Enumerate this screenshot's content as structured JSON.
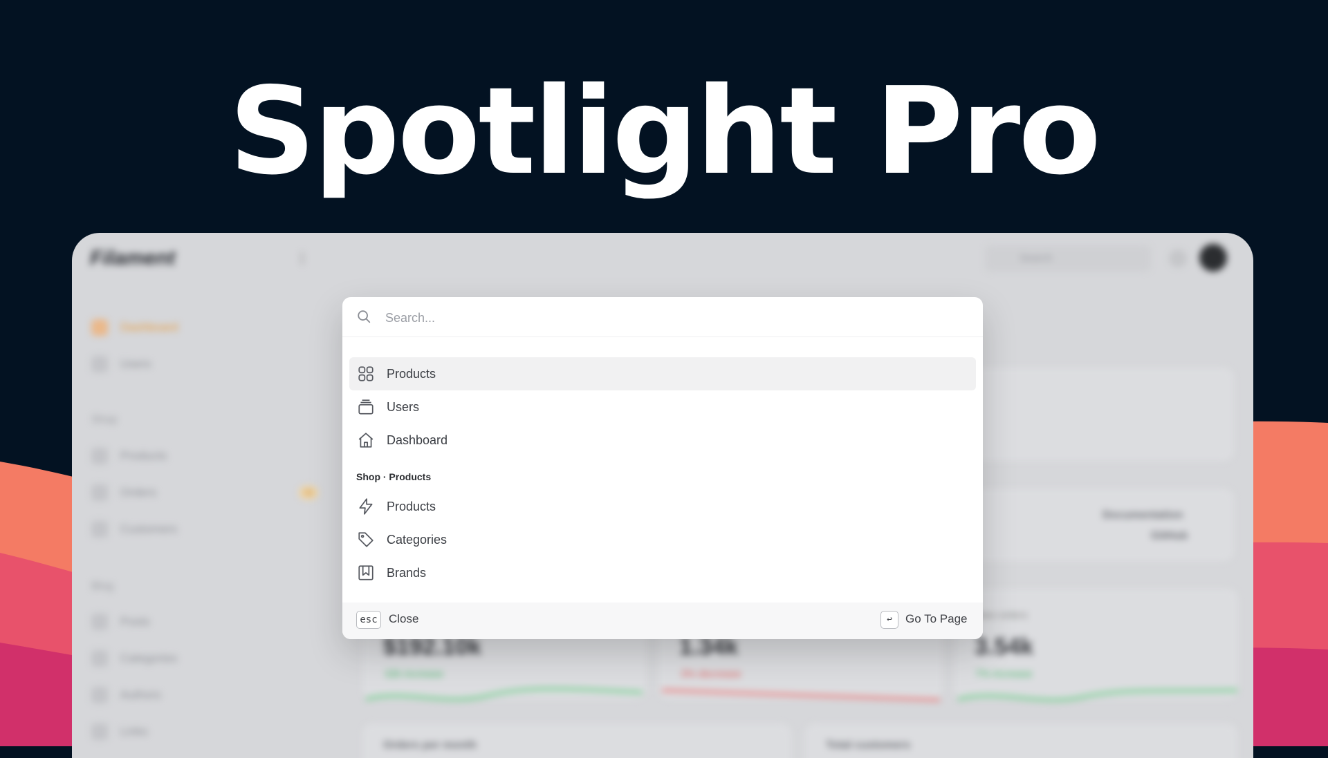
{
  "hero": {
    "title": "Spotlight Pro"
  },
  "background_app": {
    "logo": "Filament",
    "search_placeholder": "Search",
    "nav": [
      {
        "label": "Dashboard",
        "active": true
      },
      {
        "label": "Users"
      }
    ],
    "groups": [
      {
        "label": "Shop",
        "items": [
          {
            "label": "Products"
          },
          {
            "label": "Orders",
            "badge": "06"
          },
          {
            "label": "Customers"
          }
        ]
      },
      {
        "label": "Blog",
        "items": [
          {
            "label": "Posts"
          },
          {
            "label": "Categories"
          },
          {
            "label": "Authors"
          },
          {
            "label": "Links"
          }
        ]
      }
    ],
    "widgets": {
      "docs_link": "Documentation",
      "github_link": "GitHub",
      "stat_1": {
        "value": "$192.10k",
        "note": "32k increase"
      },
      "stat_2": {
        "value": "1.34k",
        "note": "3% decrease"
      },
      "stat_3": {
        "label": "New orders",
        "value": "3.54k",
        "note": "7% increase"
      },
      "chart_title_1": "Orders per month",
      "chart_title_2": "Total customers"
    }
  },
  "spotlight": {
    "search_placeholder": "Search...",
    "results": [
      {
        "label": "Products",
        "icon": "grid-icon",
        "active": true
      },
      {
        "label": "Users",
        "icon": "stack-icon"
      },
      {
        "label": "Dashboard",
        "icon": "home-icon"
      }
    ],
    "group_heading": "Shop · Products",
    "group_results": [
      {
        "label": "Products",
        "icon": "bolt-icon"
      },
      {
        "label": "Categories",
        "icon": "tag-icon"
      },
      {
        "label": "Brands",
        "icon": "bookmark-icon"
      }
    ],
    "footer": {
      "close_key": "esc",
      "close_label": "Close",
      "enter_key": "↩",
      "go_label": "Go To Page"
    }
  },
  "colors": {
    "background": "#031222",
    "wave_coral": "#f47b64",
    "wave_pink": "#e8526b",
    "wave_magenta": "#d1306a",
    "accent_active": "#e89a3a"
  }
}
